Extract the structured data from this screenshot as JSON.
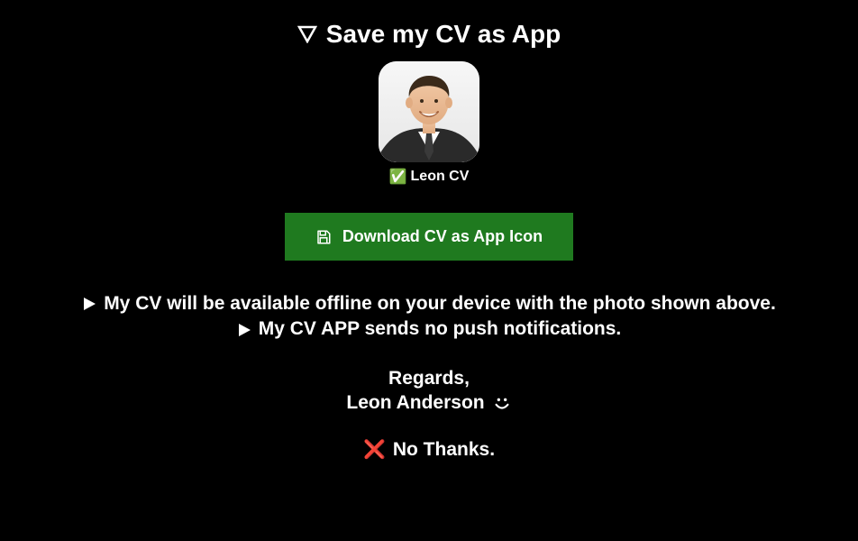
{
  "title": "Save my CV as App",
  "app": {
    "label": "Leon CV",
    "check_emoji": "✅"
  },
  "download": {
    "label": "Download CV as App Icon"
  },
  "bullets": {
    "line1": "My CV will be available offline on your device with the photo shown above.",
    "line2": "My CV APP sends no push notifications."
  },
  "regards": {
    "line1": "Regards,",
    "name": "Leon Anderson"
  },
  "no_thanks": {
    "cross_emoji": "❌",
    "label": "No Thanks."
  },
  "colors": {
    "button_bg": "#1f7a1f"
  }
}
